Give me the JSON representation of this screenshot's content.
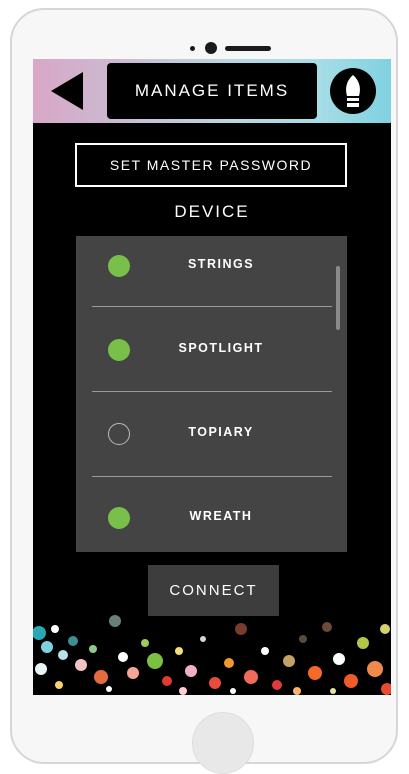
{
  "header": {
    "title": "MANAGE ITEMS"
  },
  "actions": {
    "master_password": "SET MASTER PASSWORD",
    "connect": "CONNECT"
  },
  "device_section": {
    "label": "DEVICE"
  },
  "devices": [
    {
      "name": "STRINGS",
      "selected": true
    },
    {
      "name": "SPOTLIGHT",
      "selected": true
    },
    {
      "name": "TOPIARY",
      "selected": false
    },
    {
      "name": "WREATH",
      "selected": true
    }
  ],
  "colors": {
    "accent_green": "#78c04a",
    "header_gradient_start": "#d9a7c7",
    "header_gradient_end": "#7fd1e0"
  },
  "icons": {
    "back": "back-arrow-icon",
    "settings": "light-bulb-icon"
  }
}
